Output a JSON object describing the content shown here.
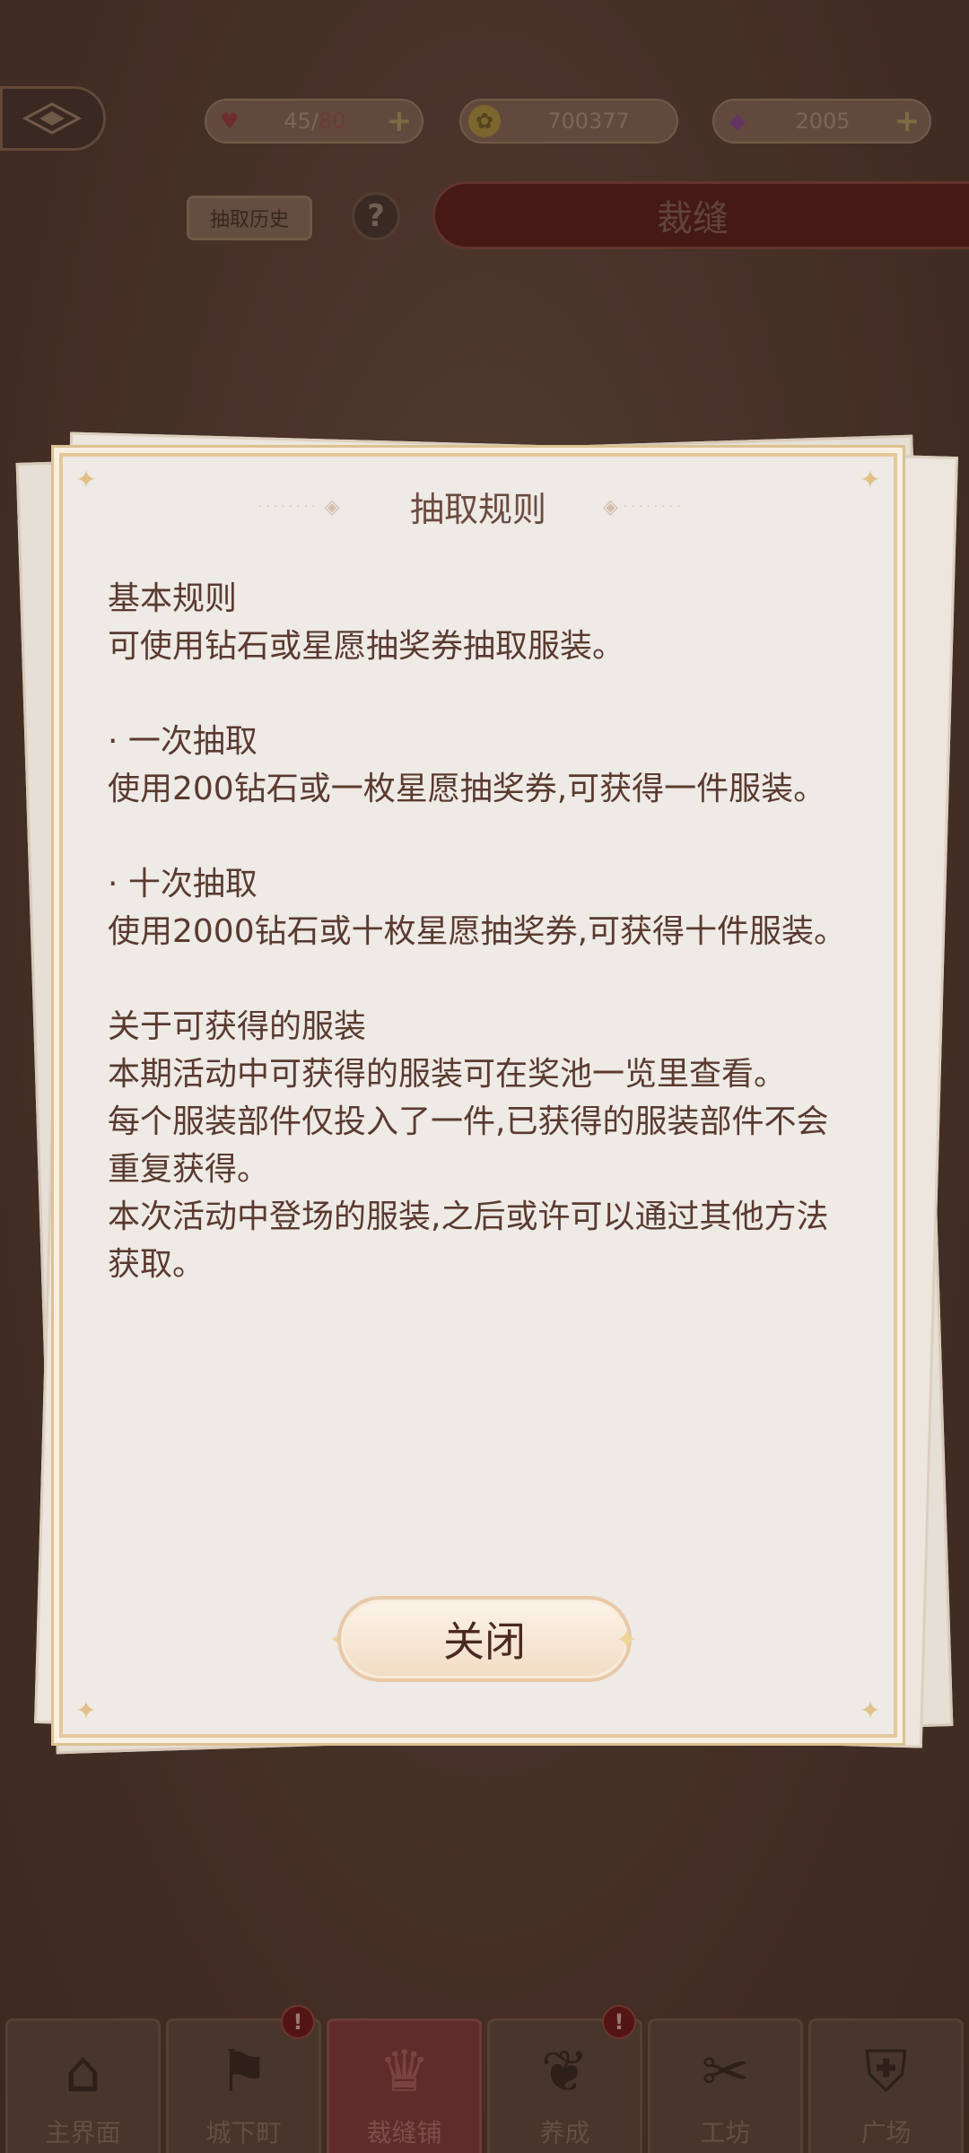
{
  "header": {
    "heart": {
      "current": "45",
      "max": "80",
      "sep": "/"
    },
    "gold": "700377",
    "gems": "2005",
    "history_label": "抽取历史",
    "help_label": "?",
    "title": "裁缝"
  },
  "modal": {
    "title": "抽取规则",
    "lines": [
      "基本规则",
      "可使用钻石或星愿抽奖券抽取服装。",
      "",
      "· 一次抽取",
      "使用200钻石或一枚星愿抽奖券,可获得一件服装。",
      "",
      "· 十次抽取",
      "使用2000钻石或十枚星愿抽奖券,可获得十件服装。",
      "",
      "关于可获得的服装",
      "本期活动中可获得的服装可在奖池一览里查看。",
      "每个服装部件仅投入了一件,已获得的服装部件不会重复获得。",
      "本次活动中登场的服装,之后或许可以通过其他方法获取。"
    ],
    "close_label": "关闭"
  },
  "nav": [
    {
      "label": "主界面",
      "icon": "house-icon",
      "active": false,
      "badge": ""
    },
    {
      "label": "城下町",
      "icon": "flags-icon",
      "active": false,
      "badge": "!"
    },
    {
      "label": "裁缝铺",
      "icon": "dress-icon",
      "active": true,
      "badge": ""
    },
    {
      "label": "养成",
      "icon": "portrait-icon",
      "active": false,
      "badge": "!"
    },
    {
      "label": "工坊",
      "icon": "thread-needle-icon",
      "active": false,
      "badge": ""
    },
    {
      "label": "广场",
      "icon": "shield-icon",
      "active": false,
      "badge": ""
    }
  ],
  "colors": {
    "background": "#4f3a30",
    "modal_bg": "#eeeae5",
    "modal_border": "#e3c89c",
    "text": "#5a3a30",
    "title_bar": "#4a1916"
  }
}
